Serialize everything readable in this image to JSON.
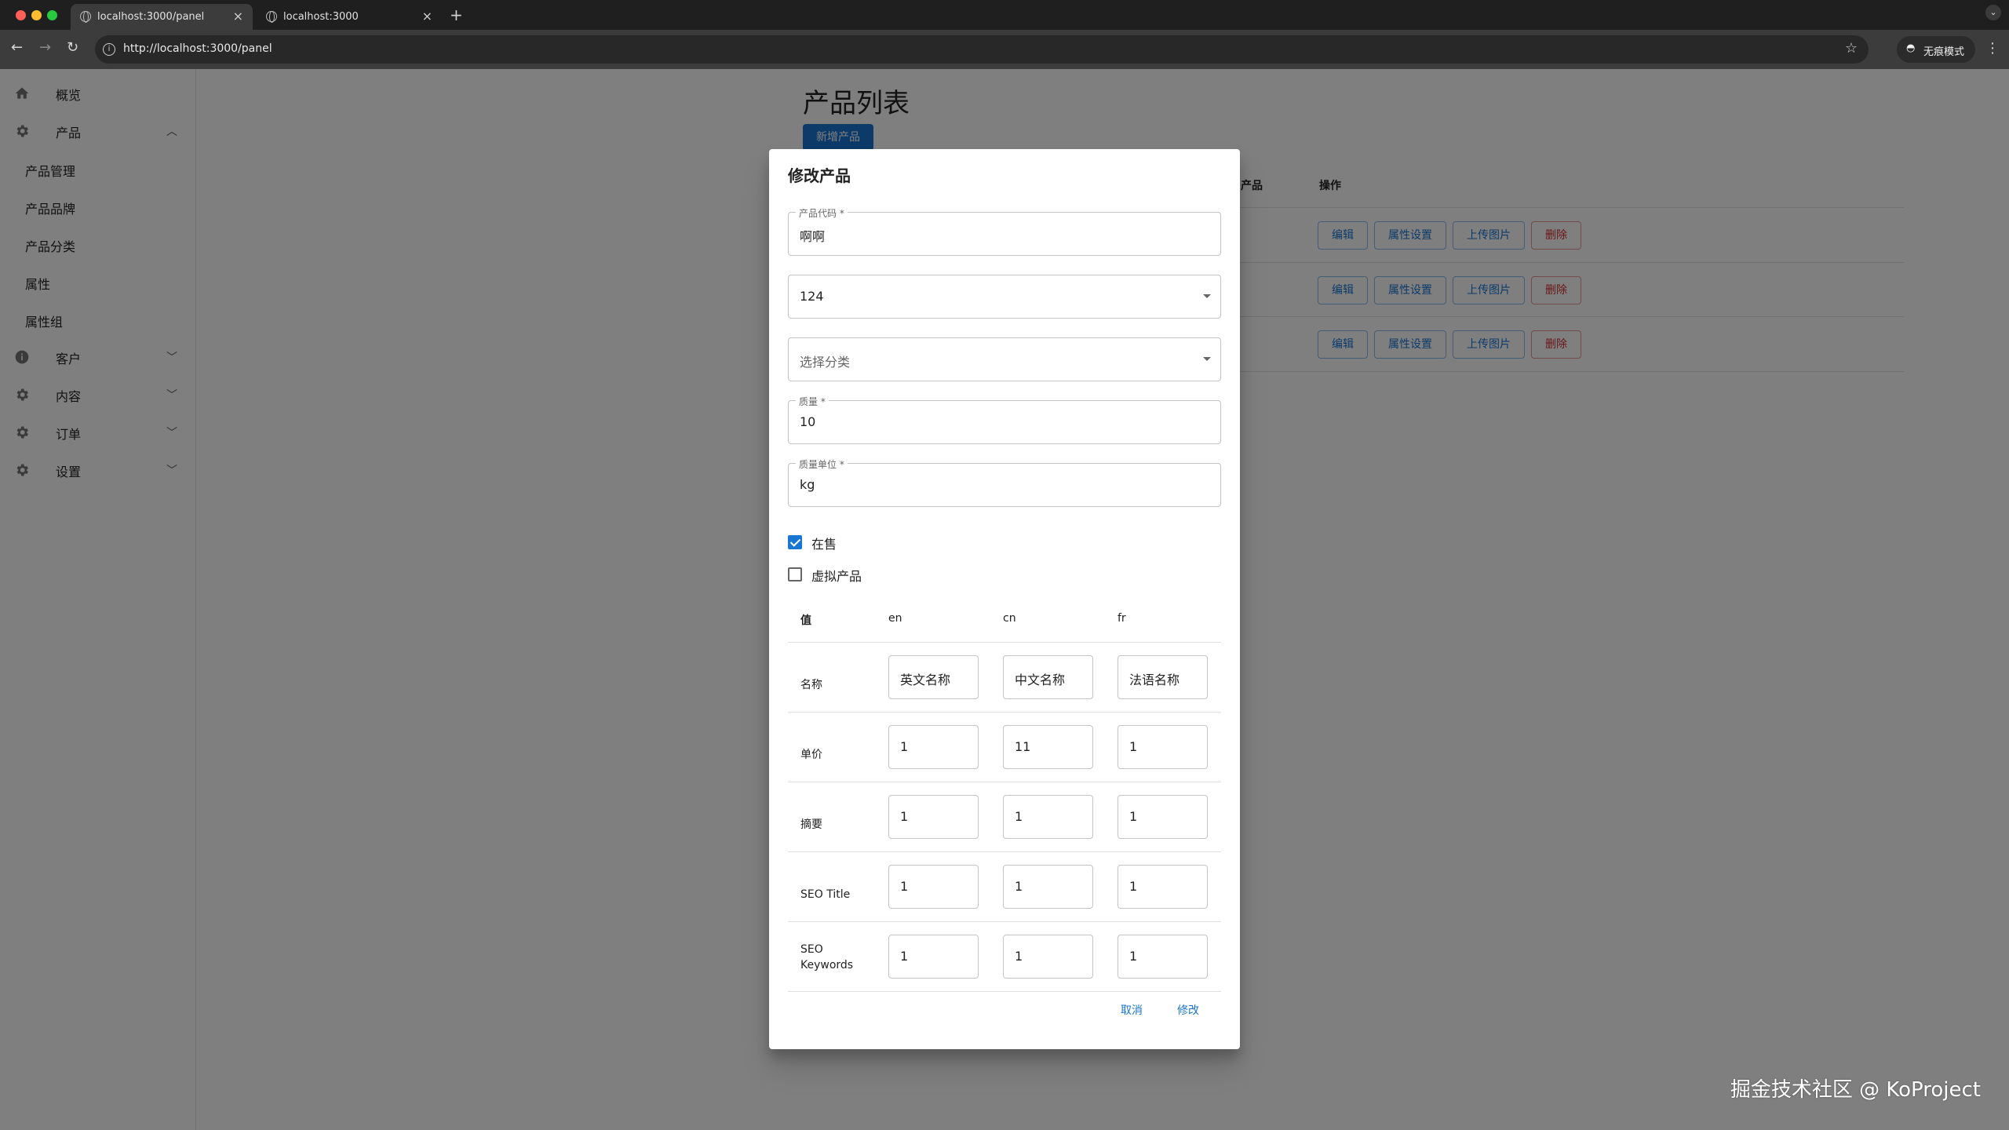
{
  "browser": {
    "tabs": [
      {
        "title": "localhost:3000/panel",
        "active": true
      },
      {
        "title": "localhost:3000",
        "active": false
      }
    ],
    "url": "http://localhost:3000/panel",
    "incognito_label": "无痕模式"
  },
  "sidebar": {
    "items": [
      {
        "label": "概览",
        "icon": "home-icon"
      },
      {
        "label": "产品",
        "icon": "gear-icon",
        "expanded": true
      },
      {
        "label": "客户",
        "icon": "info-icon"
      },
      {
        "label": "内容",
        "icon": "gear-icon"
      },
      {
        "label": "订单",
        "icon": "gear-icon"
      },
      {
        "label": "设置",
        "icon": "gear-icon"
      }
    ],
    "sub_items": [
      "产品管理",
      "产品品牌",
      "产品分类",
      "属性",
      "属性组"
    ]
  },
  "page": {
    "title": "产品列表",
    "add_button": "新增产品",
    "table": {
      "headers_visible": [
        "产品",
        "操作"
      ],
      "row_actions": [
        "编辑",
        "属性设置",
        "上传图片",
        "删除"
      ],
      "row_count": 3
    }
  },
  "dialog": {
    "title": "修改产品",
    "fields": {
      "code_label": "产品代码 *",
      "code_value": "啊啊",
      "brand_value": "124",
      "category_placeholder": "选择分类",
      "weight_label": "质量 *",
      "weight_value": "10",
      "unit_label": "质量单位 *",
      "unit_value": "kg"
    },
    "checkboxes": [
      {
        "label": "在售",
        "checked": true
      },
      {
        "label": "虚拟产品",
        "checked": false
      }
    ],
    "i18n_table": {
      "headers": [
        "值",
        "en",
        "cn",
        "fr"
      ],
      "rows": [
        {
          "label": "名称",
          "values": [
            "英文名称",
            "中文名称",
            "法语名称"
          ]
        },
        {
          "label": "单价",
          "values": [
            "1",
            "11",
            "1"
          ]
        },
        {
          "label": "摘要",
          "values": [
            "1",
            "1",
            "1"
          ]
        },
        {
          "label": "SEO Title",
          "values": [
            "1",
            "1",
            "1"
          ]
        },
        {
          "label": "SEO Keywords",
          "values": [
            "1",
            "1",
            "1"
          ]
        }
      ]
    },
    "cancel_label": "取消",
    "submit_label": "修改"
  },
  "watermark": "掘金技术社区 @ KoProject",
  "colors": {
    "primary": "#1976d2",
    "danger": "#d32f2f",
    "backdrop": "rgba(0,0,0,0.5)"
  }
}
